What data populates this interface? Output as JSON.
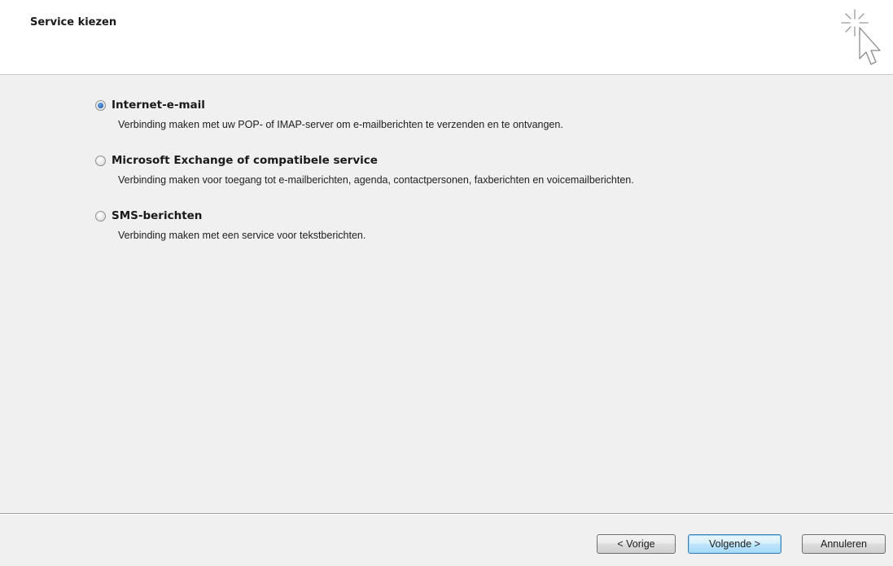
{
  "header": {
    "title": "Service kiezen",
    "icon": "wizard-sparkle-cursor-icon"
  },
  "options": [
    {
      "label": "Internet-e-mail",
      "description": "Verbinding maken met uw POP- of IMAP-server om e-mailberichten te verzenden en te ontvangen.",
      "selected": true
    },
    {
      "label": "Microsoft Exchange of compatibele service",
      "description": "Verbinding maken voor toegang tot e-mailberichten, agenda, contactpersonen, faxberichten en voicemailberichten.",
      "selected": false
    },
    {
      "label": "SMS-berichten",
      "description": "Verbinding maken met een service voor tekstberichten.",
      "selected": false
    }
  ],
  "buttons": {
    "back": "< Vorige",
    "next": "Volgende >",
    "cancel": "Annuleren"
  },
  "colors": {
    "header_bg": "#ffffff",
    "body_bg": "#f0f0f0",
    "accent": "#3c7fb1"
  }
}
